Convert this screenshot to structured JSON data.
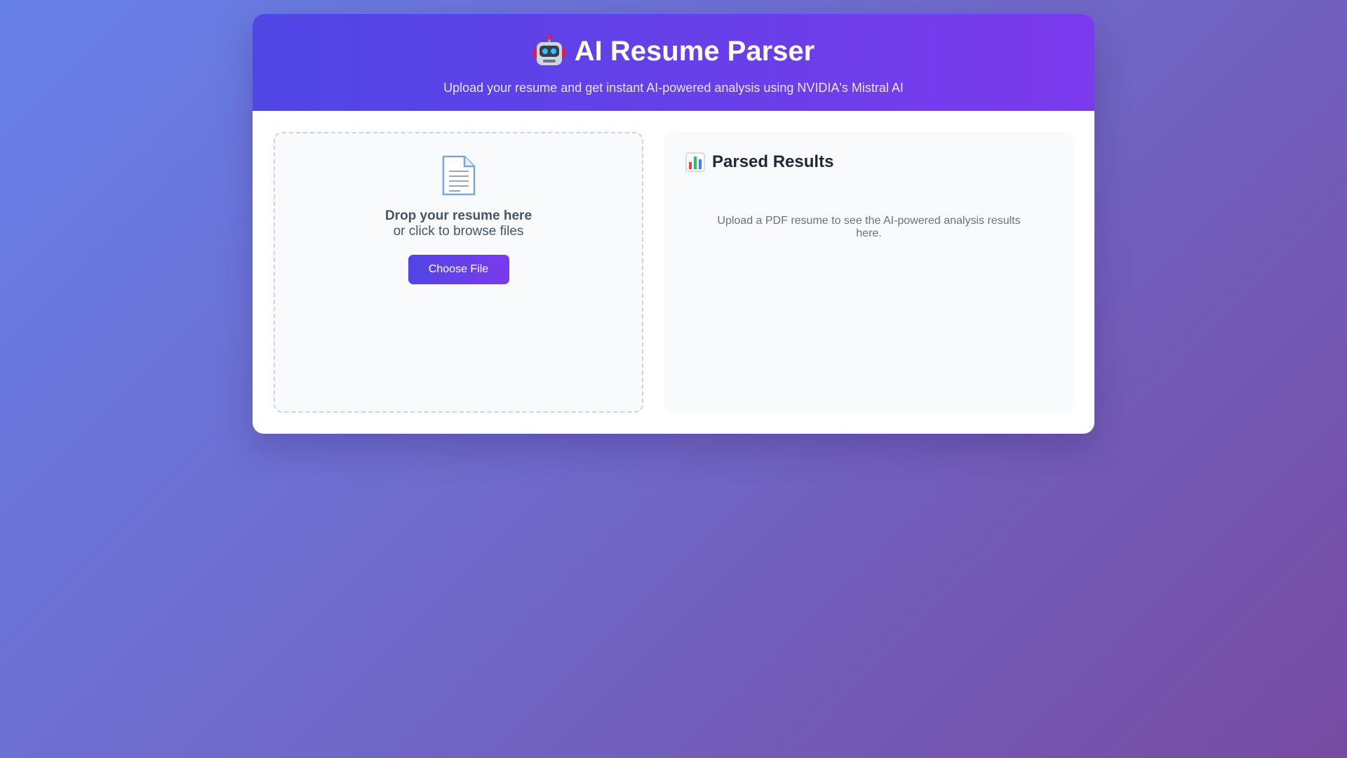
{
  "header": {
    "title": "AI Resume Parser",
    "title_icon": "robot-icon",
    "subtitle": "Upload your resume and get instant AI-powered analysis using NVIDIA's Mistral AI"
  },
  "upload": {
    "icon": "document-icon",
    "drop_title": "Drop your resume here",
    "drop_subtitle": "or click to browse files",
    "button_label": "Choose File"
  },
  "results": {
    "icon": "bar-chart-icon",
    "heading": "Parsed Results",
    "placeholder": "Upload a PDF resume to see the AI-powered analysis results here."
  },
  "colors": {
    "accent_start": "#4f46e5",
    "accent_end": "#7c3aed",
    "background_start": "#6780e9",
    "background_end": "#764ba2"
  }
}
